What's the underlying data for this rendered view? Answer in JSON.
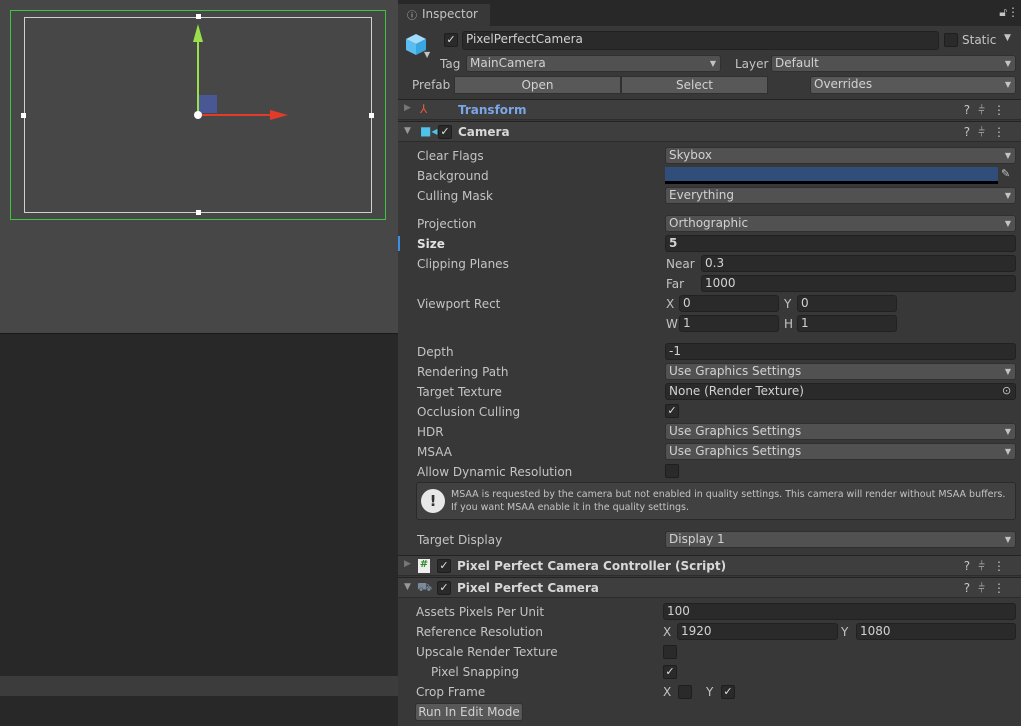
{
  "inspector": {
    "tab_label": "Inspector",
    "object_name": "PixelPerfectCamera",
    "static_label": "Static",
    "tag_label": "Tag",
    "tag_value": "MainCamera",
    "layer_label": "Layer",
    "layer_value": "Default",
    "prefab_label": "Prefab",
    "open_label": "Open",
    "select_label": "Select",
    "overrides_label": "Overrides"
  },
  "components": {
    "transform": {
      "title": "Transform"
    },
    "camera": {
      "title": "Camera",
      "clear_flags": {
        "label": "Clear Flags",
        "value": "Skybox"
      },
      "background": {
        "label": "Background",
        "color": "#314d79"
      },
      "culling_mask": {
        "label": "Culling Mask",
        "value": "Everything"
      },
      "projection": {
        "label": "Projection",
        "value": "Orthographic"
      },
      "size": {
        "label": "Size",
        "value": "5"
      },
      "clipping": {
        "label": "Clipping Planes",
        "near_label": "Near",
        "near": "0.3",
        "far_label": "Far",
        "far": "1000"
      },
      "viewport": {
        "label": "Viewport Rect",
        "x_label": "X",
        "x": "0",
        "y_label": "Y",
        "y": "0",
        "w_label": "W",
        "w": "1",
        "h_label": "H",
        "h": "1"
      },
      "depth": {
        "label": "Depth",
        "value": "-1"
      },
      "rendering_path": {
        "label": "Rendering Path",
        "value": "Use Graphics Settings"
      },
      "target_texture": {
        "label": "Target Texture",
        "value": "None (Render Texture)"
      },
      "occlusion": {
        "label": "Occlusion Culling",
        "checked": true
      },
      "hdr": {
        "label": "HDR",
        "value": "Use Graphics Settings"
      },
      "msaa": {
        "label": "MSAA",
        "value": "Use Graphics Settings"
      },
      "dynamic_res": {
        "label": "Allow Dynamic Resolution",
        "checked": false
      },
      "warning_line1": "MSAA is requested by the camera but not enabled in quality settings. This camera will render without MSAA buffers.",
      "warning_line2": "If you want MSAA enable it in the quality settings.",
      "target_display": {
        "label": "Target Display",
        "value": "Display 1"
      }
    },
    "controller": {
      "title": "Pixel Perfect Camera Controller (Script)"
    },
    "ppc": {
      "title": "Pixel Perfect Camera",
      "ppu": {
        "label": "Assets Pixels Per Unit",
        "value": "100"
      },
      "ref_res": {
        "label": "Reference Resolution",
        "x_label": "X",
        "x": "1920",
        "y_label": "Y",
        "y": "1080"
      },
      "upscale": {
        "label": "Upscale Render Texture",
        "checked": false
      },
      "snapping": {
        "label": "Pixel Snapping",
        "checked": true
      },
      "crop": {
        "label": "Crop Frame",
        "x_label": "X",
        "x": false,
        "y_label": "Y",
        "y": true
      },
      "run_button": "Run In Edit Mode"
    }
  },
  "check_glyph": "✓",
  "colors": {
    "accent_blue": "#7ba6e6",
    "selection_green": "#3ec43e"
  }
}
